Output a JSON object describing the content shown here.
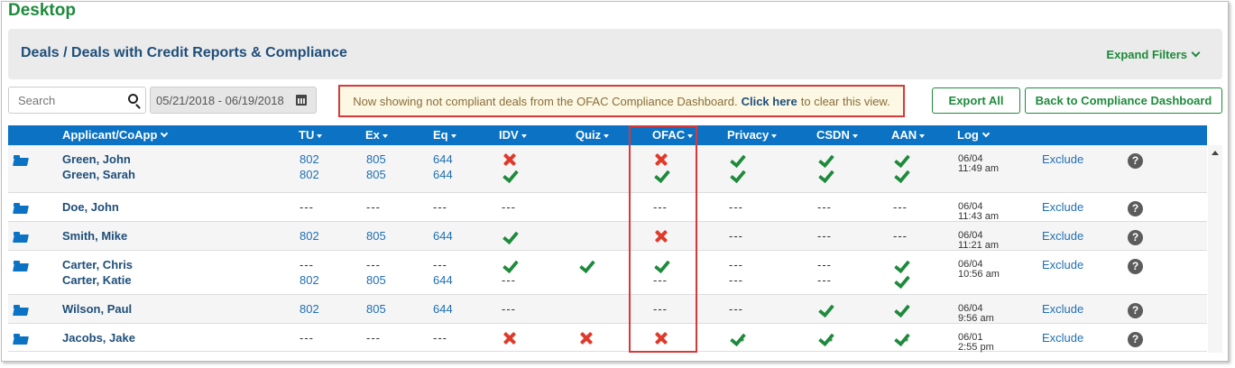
{
  "app": {
    "title": "Desktop"
  },
  "header": {
    "breadcrumb": "Deals / Deals with Credit Reports & Compliance",
    "expand_filters_label": "Expand Filters"
  },
  "search": {
    "placeholder": "Search"
  },
  "date_range": {
    "value": "05/21/2018 - 06/19/2018"
  },
  "notice": {
    "before": "Now showing not compliant deals from the OFAC Compliance Dashboard.",
    "link": "Click here",
    "after": "to clear this view."
  },
  "buttons": {
    "export_all": "Export All",
    "back": "Back to Compliance Dashboard"
  },
  "columns": {
    "applicant": "Applicant/CoApp",
    "tu": "TU",
    "ex": "Ex",
    "eq": "Eq",
    "idv": "IDV",
    "quiz": "Quiz",
    "ofac": "OFAC",
    "privacy": "Privacy",
    "csdn": "CSDN",
    "aan": "AAN",
    "log": "Log"
  },
  "colors": {
    "brand_green": "#1e8a3c",
    "header_blue": "#0b72c4",
    "error_red": "#e03a2a"
  },
  "rows": [
    {
      "names": [
        "Green, John",
        "Green, Sarah"
      ],
      "tu": [
        "802",
        "802"
      ],
      "ex": [
        "805",
        "805"
      ],
      "eq": [
        "644",
        "644"
      ],
      "idv": [
        "x",
        "check"
      ],
      "quiz": [
        "",
        ""
      ],
      "ofac": [
        "x",
        "check"
      ],
      "privacy": [
        "check",
        "check"
      ],
      "csdn": [
        "check",
        "check"
      ],
      "aan": [
        "check",
        "check"
      ],
      "log_date": "06/04",
      "log_time": "11:49 am",
      "action": "Exclude"
    },
    {
      "names": [
        "Doe, John"
      ],
      "tu": [
        "---"
      ],
      "ex": [
        "---"
      ],
      "eq": [
        "---"
      ],
      "idv": [
        "---"
      ],
      "quiz": [
        ""
      ],
      "ofac": [
        "---"
      ],
      "privacy": [
        "---"
      ],
      "csdn": [
        "---"
      ],
      "aan": [
        "---"
      ],
      "log_date": "06/04",
      "log_time": "11:43 am",
      "action": "Exclude"
    },
    {
      "names": [
        "Smith, Mike"
      ],
      "tu": [
        "802"
      ],
      "ex": [
        "805"
      ],
      "eq": [
        "644"
      ],
      "idv": [
        "check"
      ],
      "quiz": [
        ""
      ],
      "ofac": [
        "x"
      ],
      "privacy": [
        "---"
      ],
      "csdn": [
        "---"
      ],
      "aan": [
        "---"
      ],
      "log_date": "06/04",
      "log_time": "11:21 am",
      "action": "Exclude"
    },
    {
      "names": [
        "Carter, Chris",
        "Carter, Katie"
      ],
      "tu": [
        "---",
        "802"
      ],
      "ex": [
        "---",
        "805"
      ],
      "eq": [
        "---",
        "644"
      ],
      "idv": [
        "check",
        "---"
      ],
      "quiz": [
        "check",
        ""
      ],
      "ofac": [
        "check",
        "---"
      ],
      "privacy": [
        "---",
        "---"
      ],
      "csdn": [
        "---",
        "---"
      ],
      "aan": [
        "check",
        "check"
      ],
      "log_date": "06/04",
      "log_time": "10:56 am",
      "action": "Exclude"
    },
    {
      "names": [
        "Wilson, Paul"
      ],
      "tu": [
        "802"
      ],
      "ex": [
        "805"
      ],
      "eq": [
        "644"
      ],
      "idv": [
        "---"
      ],
      "quiz": [
        ""
      ],
      "ofac": [
        "---"
      ],
      "privacy": [
        "---"
      ],
      "csdn": [
        "check"
      ],
      "aan": [
        "check"
      ],
      "log_date": "06/04",
      "log_time": "9:56 am",
      "action": "Exclude"
    },
    {
      "names": [
        "Jacobs, Jake"
      ],
      "tu": [
        "---"
      ],
      "ex": [
        "---"
      ],
      "eq": [
        "---"
      ],
      "idv": [
        "x"
      ],
      "quiz": [
        "x"
      ],
      "ofac": [
        "x"
      ],
      "privacy": [
        "check-star"
      ],
      "csdn": [
        "check-star"
      ],
      "aan": [
        "check-star"
      ],
      "log_date": "06/01",
      "log_time": "2:55 pm",
      "action": "Exclude"
    }
  ]
}
